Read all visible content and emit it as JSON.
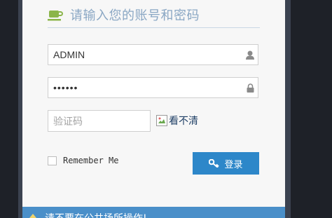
{
  "header": {
    "icon": "coffee-cup-icon",
    "title": "请输入您的账号和密码"
  },
  "form": {
    "username": {
      "value": "ADMIN",
      "icon": "user-icon"
    },
    "password": {
      "value": "••••••",
      "icon": "lock-icon"
    },
    "captcha": {
      "placeholder": "验证码",
      "image_icon": "broken-image-icon",
      "refresh_label": "看不清"
    },
    "remember_label": "Remember Me",
    "login_button": {
      "label": "登录",
      "icon": "key-icon"
    }
  },
  "footer": {
    "notice": "请不要在公共场所操作!"
  },
  "colors": {
    "panel_bg": "#f7f7f7",
    "page_bg": "#1e2128",
    "accent": "#2d87c9",
    "title_text": "#8aa7c4"
  }
}
